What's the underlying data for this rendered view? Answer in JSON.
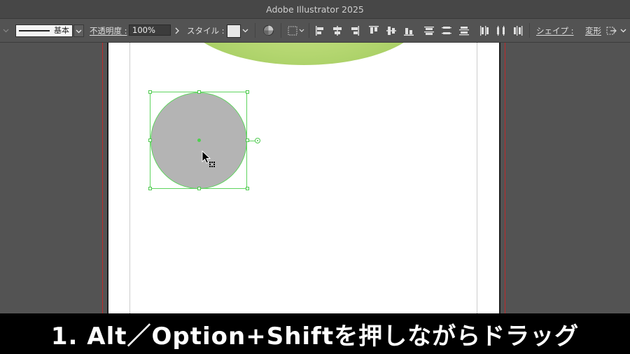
{
  "window": {
    "title": "Adobe Illustrator 2025"
  },
  "controlbar": {
    "stroke_label": "基本",
    "opacity_label": "不透明度 :",
    "opacity_value": "100%",
    "style_label": "スタイル :",
    "shape_label": "シェイプ :",
    "transform_label": "変形"
  },
  "canvas": {
    "selected_object": "circle",
    "fill_color": "#b4b4b4",
    "selection_color": "#5ed45e"
  },
  "caption": {
    "text": "1. Alt／Option+Shiftを押しながらドラッグ"
  }
}
